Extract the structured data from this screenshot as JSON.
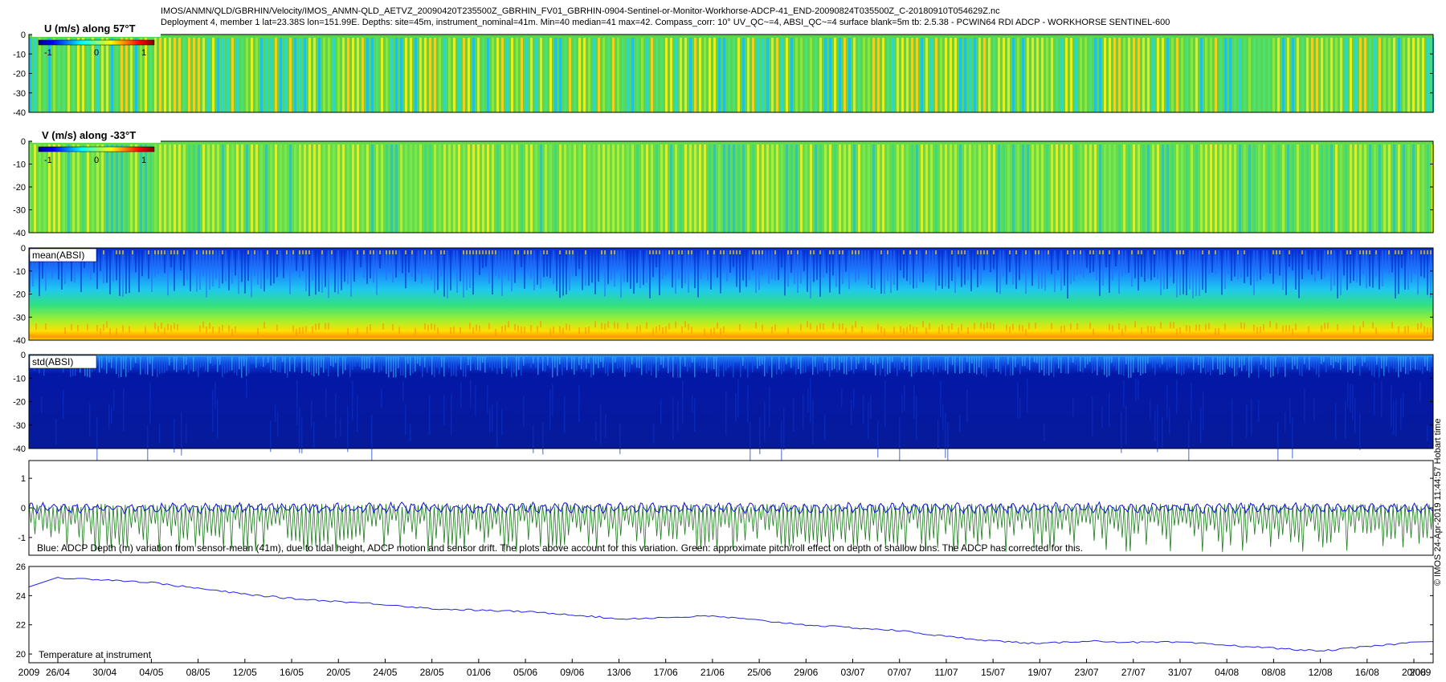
{
  "header": {
    "line1": "IMOS/ANMN/QLD/GBRHIN/Velocity/IMOS_ANMN-QLD_AETVZ_20090420T235500Z_GBRHIN_FV01_GBRHIN-0904-Sentinel-or-Monitor-Workhorse-ADCP-41_END-20090824T035500Z_C-20180910T054629Z.nc",
    "line2": "Deployment 4, member 1 lat=23.38S lon=151.99E. Depths: site=45m, instrument_nominal=41m. Min=40 median=41 max=42. Compass_corr: 10° UV_QC~=4, ABSI_QC~=4 surface blank=5m tb: 2.5.38 - PCWIN64 RDI ADCP - WORKHORSE SENTINEL-600"
  },
  "credit": "© IMOS 24-Apr-2019 11:44:57 Hobart time",
  "colors": {
    "blue_line": "#1010e0",
    "green_line": "#1a7a1a",
    "temp_line": "#2222ee"
  },
  "chart_data": [
    {
      "type": "heatmap",
      "title": "U (m/s) along 57°T",
      "colorbar_ticks": [
        "-1",
        "0",
        "1"
      ],
      "colorbar_range": [
        -1,
        1
      ],
      "y_ticks": [
        "0",
        "-10",
        "-20",
        "-30",
        "-40"
      ],
      "ylim": [
        -40,
        0
      ],
      "colormap": "jet",
      "pattern": "dense vertical stripes, mostly green with yellow/cyan alternation"
    },
    {
      "type": "heatmap",
      "title": "V (m/s) along -33°T",
      "colorbar_ticks": [
        "-1",
        "0",
        "1"
      ],
      "colorbar_range": [
        -1,
        1
      ],
      "y_ticks": [
        "0",
        "-10",
        "-20",
        "-30",
        "-40"
      ],
      "ylim": [
        -40,
        0
      ],
      "colormap": "jet",
      "pattern": "dense vertical stripes, green with light-green alternation"
    },
    {
      "type": "heatmap",
      "title": "mean(ABSI)",
      "y_ticks": [
        "0",
        "-10",
        "-20",
        "-30",
        "-40"
      ],
      "ylim": [
        -40,
        0
      ],
      "colormap": "jet",
      "pattern": "blue near surface, cyan/green mid-depth, yellow/orange near bottom"
    },
    {
      "type": "heatmap",
      "title": "std(ABSI)",
      "y_ticks": [
        "0",
        "-10",
        "-20",
        "-30",
        "-40"
      ],
      "ylim": [
        -40,
        0
      ],
      "colormap": "jet",
      "pattern": "mostly dark blue, light blue near surface"
    },
    {
      "type": "line",
      "y_ticks": [
        "1",
        "0",
        "-1"
      ],
      "ylim": [
        -1.6,
        1.6
      ],
      "caption": "Blue: ADCP Depth (m) variation from sensor-mean (41m), due to tidal height, ADCP motion and sensor drift. The plots above account for this variation. Green: approximate pitch/roll effect on depth of shallow bins. The ADCP has corrected for this.",
      "blue_range": [
        -0.2,
        0.2
      ],
      "green_range": [
        -1.5,
        0.15
      ]
    },
    {
      "type": "line",
      "y_ticks": [
        "26",
        "24",
        "22",
        "20"
      ],
      "ylim": [
        19.4,
        26
      ],
      "label": "Temperature at instrument",
      "x": [
        "26/04",
        "30/04",
        "04/05",
        "08/05",
        "12/05",
        "16/05",
        "20/05",
        "24/05",
        "28/05",
        "01/06",
        "05/06",
        "09/06",
        "13/06",
        "17/06",
        "21/06",
        "25/06",
        "29/06",
        "03/07",
        "07/07",
        "11/07",
        "15/07",
        "19/07",
        "23/07",
        "27/07",
        "31/07",
        "04/08",
        "08/08",
        "12/08",
        "16/08",
        "20/08"
      ],
      "values": [
        25.2,
        25.1,
        24.9,
        24.5,
        24.1,
        23.8,
        23.6,
        23.4,
        23.1,
        23.0,
        22.9,
        22.7,
        22.4,
        22.5,
        22.6,
        22.3,
        22.0,
        21.8,
        21.6,
        21.2,
        20.9,
        20.7,
        20.9,
        20.8,
        20.8,
        20.6,
        20.4,
        20.2,
        20.5,
        20.8
      ]
    }
  ],
  "x_axis": {
    "start_label": "2009",
    "end_label": "2009",
    "ticks": [
      "26/04",
      "30/04",
      "04/05",
      "08/05",
      "12/05",
      "16/05",
      "20/05",
      "24/05",
      "28/05",
      "01/06",
      "05/06",
      "09/06",
      "13/06",
      "17/06",
      "21/06",
      "25/06",
      "29/06",
      "03/07",
      "07/07",
      "11/07",
      "15/07",
      "19/07",
      "23/07",
      "27/07",
      "31/07",
      "04/08",
      "08/08",
      "12/08",
      "16/08",
      "20/08"
    ]
  }
}
